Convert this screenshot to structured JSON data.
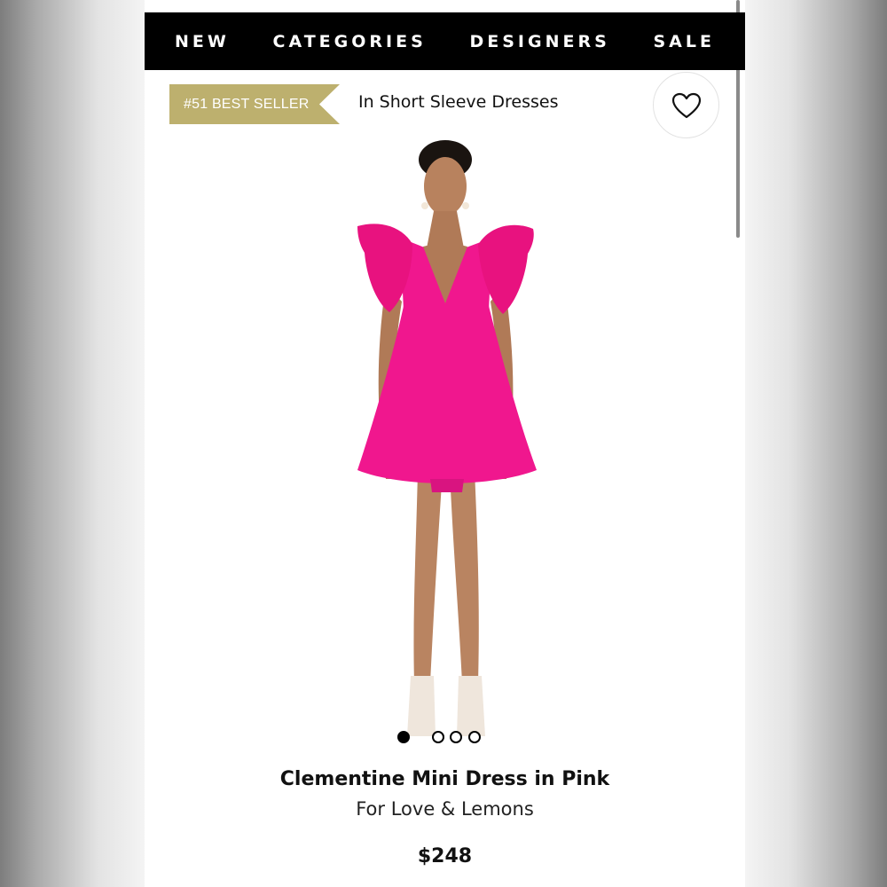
{
  "nav": {
    "items": [
      {
        "label": "NEW"
      },
      {
        "label": "CATEGORIES"
      },
      {
        "label": "DESIGNERS"
      },
      {
        "label": "SALE"
      }
    ]
  },
  "badge": {
    "label": "#51 BEST SELLER",
    "color": "#bdb06e"
  },
  "category": {
    "text": "In Short Sleeve Dresses"
  },
  "wishlist": {
    "icon": "heart-icon"
  },
  "carousel": {
    "count": 4,
    "active_index": 0
  },
  "product": {
    "name": "Clementine Mini Dress in Pink",
    "brand": "For Love & Lemons",
    "price": "$248",
    "dress_color": "#f0178e"
  }
}
